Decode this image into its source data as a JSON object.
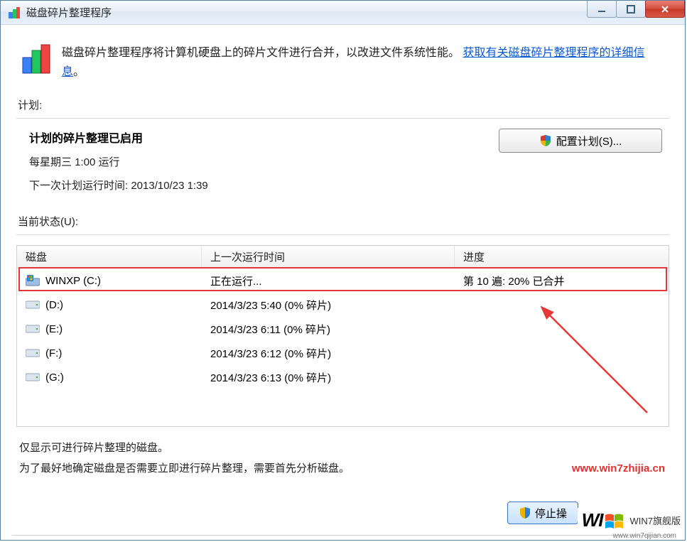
{
  "window": {
    "title": "磁盘碎片整理程序"
  },
  "intro": {
    "text_before_link": "磁盘碎片整理程序将计算机硬盘上的碎片文件进行合并，以改进文件系统性能。",
    "link_text": "获取有关磁盘碎片整理程序的详细信息",
    "period": "。"
  },
  "schedule": {
    "section_label": "计划:",
    "heading": "计划的碎片整理已启用",
    "run_time": "每星期三   1:00 运行",
    "next_run": "下一次计划运行时间: 2013/10/23 1:39",
    "config_button": "配置计划(S)..."
  },
  "status": {
    "section_label": "当前状态(U):",
    "columns": {
      "disk": "磁盘",
      "last": "上一次运行时间",
      "progress": "进度"
    },
    "rows": [
      {
        "name": "WINXP (C:)",
        "last": "正在运行...",
        "progress": "第 10 遍: 20% 已合并",
        "icon": "os"
      },
      {
        "name": "(D:)",
        "last": "2014/3/23 5:40 (0% 碎片)",
        "progress": "",
        "icon": "hdd"
      },
      {
        "name": "(E:)",
        "last": "2014/3/23 6:11 (0% 碎片)",
        "progress": "",
        "icon": "hdd"
      },
      {
        "name": "(F:)",
        "last": "2014/3/23 6:12 (0% 碎片)",
        "progress": "",
        "icon": "hdd"
      },
      {
        "name": "(G:)",
        "last": "2014/3/23 6:13 (0% 碎片)",
        "progress": "",
        "icon": "hdd"
      }
    ]
  },
  "notes": {
    "line1": "仅显示可进行碎片整理的磁盘。",
    "line2": "为了最好地确定磁盘是否需要立即进行碎片整理，需要首先分析磁盘。"
  },
  "buttons": {
    "stop": "停止操"
  },
  "watermark": {
    "url": "www.win7zhijia.cn",
    "logo_text": "WI",
    "logo_sub": "WIN7旗舰版",
    "tiny_url": "www.win7qijian.com"
  }
}
